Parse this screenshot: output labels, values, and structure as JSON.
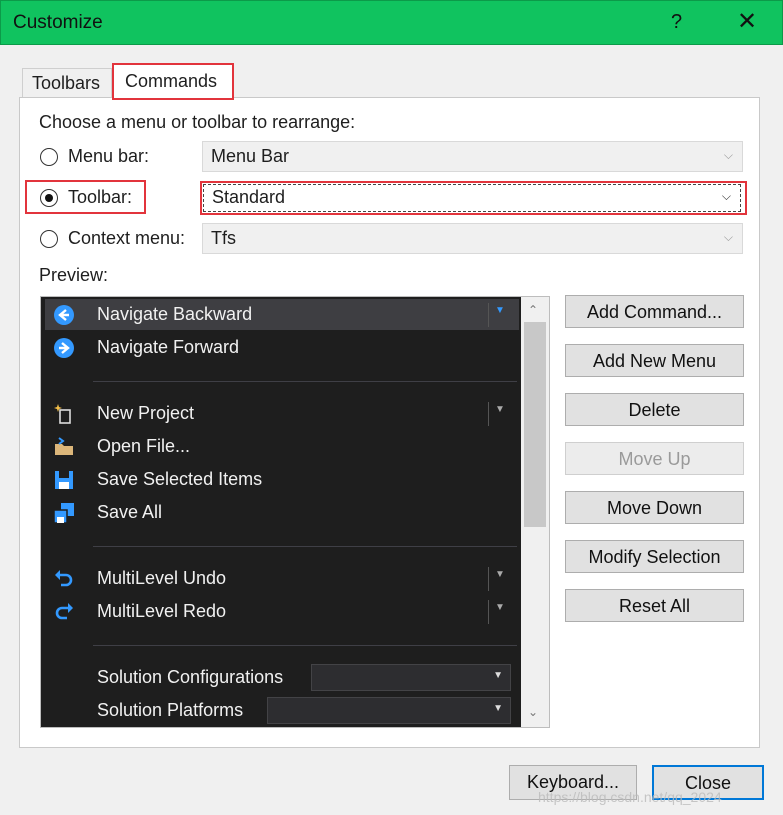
{
  "window": {
    "title": "Customize",
    "help_glyph": "?",
    "close_glyph": "✕"
  },
  "tabs": [
    {
      "label": "Toolbars"
    },
    {
      "label": "Commands"
    }
  ],
  "section": {
    "prompt": "Choose a menu or toolbar to rearrange:",
    "options": [
      {
        "label": "Menu bar:",
        "value": "Menu Bar",
        "checked": false
      },
      {
        "label": "Toolbar:",
        "value": "Standard",
        "checked": true
      },
      {
        "label": "Context menu:",
        "value": "Tfs",
        "checked": false
      }
    ],
    "preview_label": "Preview:"
  },
  "preview_items": [
    {
      "label": "Navigate Backward",
      "icon": "back-arrow-icon"
    },
    {
      "label": "Navigate Forward",
      "icon": "forward-arrow-icon"
    },
    {
      "label": "New Project",
      "icon": "new-project-icon"
    },
    {
      "label": "Open File...",
      "icon": "open-folder-icon"
    },
    {
      "label": "Save Selected Items",
      "icon": "save-icon"
    },
    {
      "label": "Save All",
      "icon": "save-all-icon"
    },
    {
      "label": "MultiLevel Undo",
      "icon": "undo-icon"
    },
    {
      "label": "MultiLevel Redo",
      "icon": "redo-icon"
    },
    {
      "label": "Solution Configurations",
      "icon": ""
    },
    {
      "label": "Solution Platforms",
      "icon": ""
    }
  ],
  "buttons": {
    "add_command": "Add Command...",
    "add_new_menu": "Add New Menu",
    "delete": "Delete",
    "move_up": "Move Up",
    "move_down": "Move Down",
    "modify_selection": "Modify Selection",
    "reset_all": "Reset All",
    "keyboard": "Keyboard...",
    "close": "Close"
  },
  "watermark": "https://blog.csdn.net/qq_2024",
  "colors": {
    "titlebar": "#10c35f",
    "highlight": "#e2343c",
    "preview_bg": "#1e1e1e",
    "icon_blue": "#3399ff"
  }
}
